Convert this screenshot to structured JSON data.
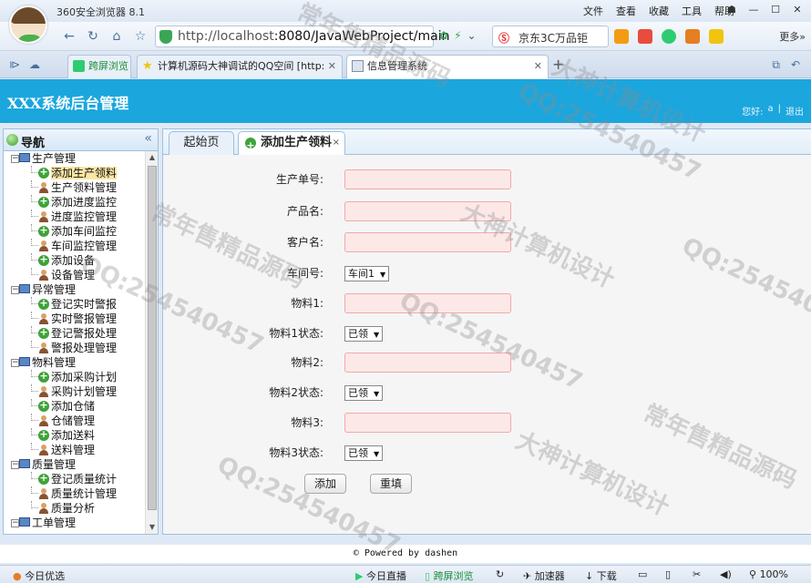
{
  "browser": {
    "app_title": "360安全浏览器 8.1",
    "menu": [
      "文件",
      "查看",
      "收藏",
      "工具",
      "帮助"
    ],
    "address_url_host": "http://localhost",
    "address_url_rest": ":8080/JavaWebProject/main",
    "search_text": "京东3C万品钜",
    "more_label": "更多»",
    "tabs": [
      {
        "label": "跨屏浏览"
      },
      {
        "label": "计算机源码大神调试的QQ空间 [http:"
      },
      {
        "label": "信息管理系统"
      }
    ]
  },
  "site": {
    "title": "XXX系统后台管理",
    "greeting": "您好:",
    "user": "a",
    "separator": "|",
    "logout": "退出"
  },
  "sidebar": {
    "title": "导航",
    "collapse_icon": "«",
    "groups": [
      {
        "label": "生产管理",
        "items": [
          {
            "label": "添加生产领料",
            "icon": "plus",
            "selected": true
          },
          {
            "label": "生产领料管理",
            "icon": "person"
          },
          {
            "label": "添加进度监控",
            "icon": "plus"
          },
          {
            "label": "进度监控管理",
            "icon": "person"
          },
          {
            "label": "添加车间监控",
            "icon": "plus"
          },
          {
            "label": "车间监控管理",
            "icon": "person"
          },
          {
            "label": "添加设备",
            "icon": "plus"
          },
          {
            "label": "设备管理",
            "icon": "person"
          }
        ]
      },
      {
        "label": "异常管理",
        "items": [
          {
            "label": "登记实时警报",
            "icon": "plus"
          },
          {
            "label": "实时警报管理",
            "icon": "person"
          },
          {
            "label": "登记警报处理",
            "icon": "plus"
          },
          {
            "label": "警报处理管理",
            "icon": "person"
          }
        ]
      },
      {
        "label": "物料管理",
        "items": [
          {
            "label": "添加采购计划",
            "icon": "plus"
          },
          {
            "label": "采购计划管理",
            "icon": "person"
          },
          {
            "label": "添加仓储",
            "icon": "plus"
          },
          {
            "label": "仓储管理",
            "icon": "person"
          },
          {
            "label": "添加送料",
            "icon": "plus"
          },
          {
            "label": "送料管理",
            "icon": "person"
          }
        ]
      },
      {
        "label": "质量管理",
        "items": [
          {
            "label": "登记质量统计",
            "icon": "plus"
          },
          {
            "label": "质量统计管理",
            "icon": "person"
          },
          {
            "label": "质量分析",
            "icon": "person"
          }
        ]
      },
      {
        "label": "工单管理",
        "items": []
      }
    ]
  },
  "page_tabs": [
    {
      "label": "起始页",
      "active": false
    },
    {
      "label": "添加生产领料",
      "active": true,
      "close": "×"
    }
  ],
  "form": {
    "fields": [
      {
        "label": "生产单号:",
        "type": "text",
        "value": ""
      },
      {
        "label": "产品名:",
        "type": "text",
        "value": ""
      },
      {
        "label": "客户名:",
        "type": "text",
        "value": ""
      },
      {
        "label": "车间号:",
        "type": "select",
        "value": "车间1"
      },
      {
        "label": "物料1:",
        "type": "text",
        "value": ""
      },
      {
        "label": "物料1状态:",
        "type": "select",
        "value": "已领"
      },
      {
        "label": "物料2:",
        "type": "text",
        "value": ""
      },
      {
        "label": "物料2状态:",
        "type": "select",
        "value": "已领"
      },
      {
        "label": "物料3:",
        "type": "text",
        "value": ""
      },
      {
        "label": "物料3状态:",
        "type": "select",
        "value": "已领"
      }
    ],
    "submit_label": "添加",
    "reset_label": "重填"
  },
  "footer": "© Powered by dashen",
  "statusbar": {
    "left": "今日优选",
    "items": [
      "今日直播",
      "跨屏浏览",
      "加速器",
      "下载"
    ],
    "zoom": "100%"
  },
  "watermarks": [
    "大神计算机设计",
    "QQ:254540457",
    "常年售精品源码"
  ],
  "colors": {
    "header": "#1ba6de",
    "selected_item": "#fbe6a4",
    "input_bg": "#fde8e8"
  }
}
